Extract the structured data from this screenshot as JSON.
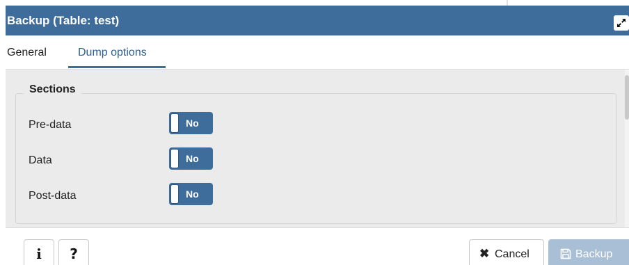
{
  "dialog": {
    "title": "Backup (Table: test)",
    "maximize_icon": "expand-arrows-icon"
  },
  "tabs": [
    {
      "label": "General",
      "active": false
    },
    {
      "label": "Dump options",
      "active": true
    }
  ],
  "sections": {
    "legend": "Sections",
    "rows": [
      {
        "label": "Pre-data",
        "value": "No"
      },
      {
        "label": "Data",
        "value": "No"
      },
      {
        "label": "Post-data",
        "value": "No"
      }
    ]
  },
  "footer": {
    "info_label": "i",
    "help_label": "?",
    "cancel_icon": "close-x-icon",
    "cancel_label": "Cancel",
    "backup_icon": "floppy-disk-icon",
    "backup_label": "Backup"
  },
  "colors": {
    "title_bar": "#3f6d9b",
    "toggle": "#3f6d9b",
    "backup_button_disabled": "#a9bfd6",
    "panel_background": "#ebebeb"
  }
}
